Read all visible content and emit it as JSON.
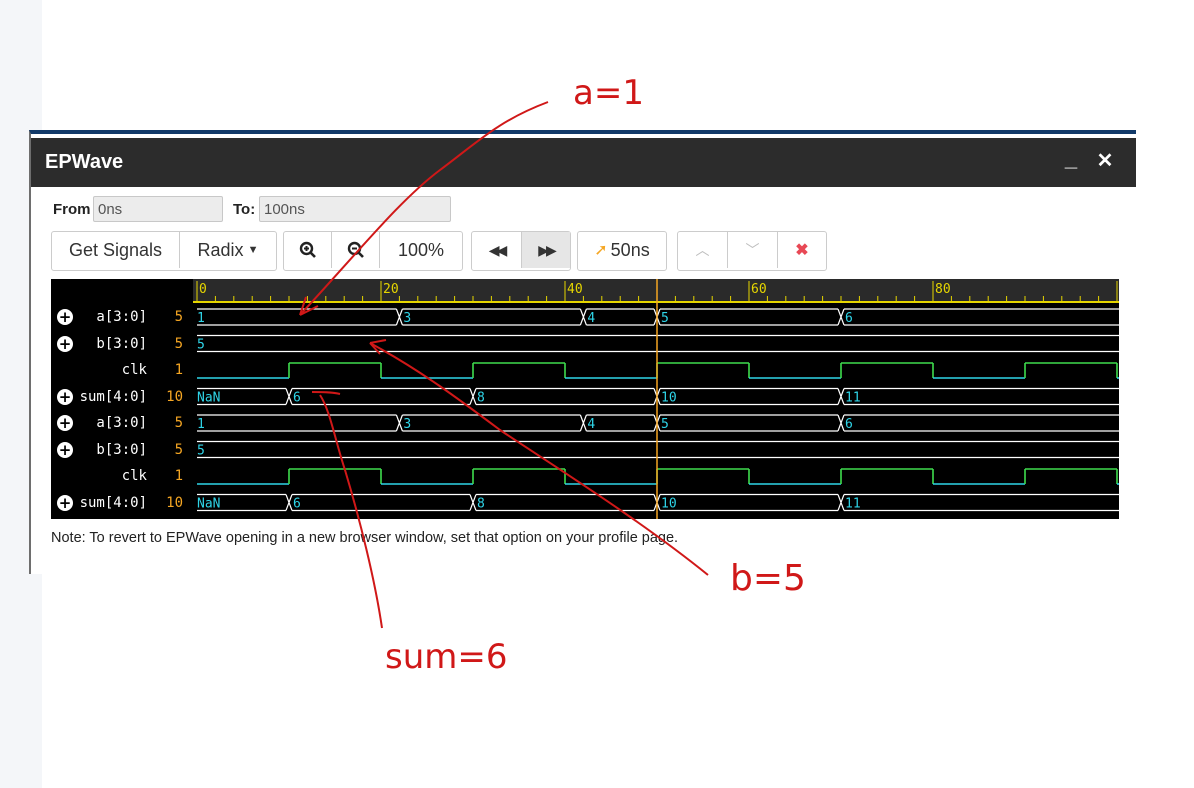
{
  "window": {
    "title": "EPWave"
  },
  "range": {
    "from_label": "From",
    "from_value": "0ns",
    "to_label": "To:",
    "to_value": "100ns"
  },
  "toolbar": {
    "get_signals": "Get Signals",
    "radix": "Radix",
    "zoom_level": "100%",
    "cursor_time": "50ns"
  },
  "ruler": {
    "ticks": [
      "0",
      "20",
      "40",
      "60",
      "80"
    ],
    "cursor_ns": 50
  },
  "signals": [
    {
      "name": "a[3:0]",
      "value": "5",
      "expandable": true
    },
    {
      "name": "b[3:0]",
      "value": "5",
      "expandable": true
    },
    {
      "name": "clk",
      "value": "1",
      "expandable": false
    },
    {
      "name": "sum[4:0]",
      "value": "10",
      "expandable": true
    },
    {
      "name": "a[3:0]",
      "value": "5",
      "expandable": true
    },
    {
      "name": "b[3:0]",
      "value": "5",
      "expandable": true
    },
    {
      "name": "clk",
      "value": "1",
      "expandable": false
    },
    {
      "name": "sum[4:0]",
      "value": "10",
      "expandable": true
    }
  ],
  "waves": {
    "a": [
      {
        "t": 0,
        "v": "1"
      },
      {
        "t": 22,
        "v": "3"
      },
      {
        "t": 42,
        "v": "4"
      },
      {
        "t": 50,
        "v": "5"
      },
      {
        "t": 70,
        "v": "6"
      }
    ],
    "b": [
      {
        "t": 0,
        "v": "5"
      }
    ],
    "clk_edges": [
      10,
      20,
      30,
      40,
      50,
      60,
      70,
      80,
      90,
      100
    ],
    "sum": [
      {
        "t": 0,
        "v": "NaN"
      },
      {
        "t": 10,
        "v": "6"
      },
      {
        "t": 30,
        "v": "8"
      },
      {
        "t": 50,
        "v": "10"
      },
      {
        "t": 70,
        "v": "11"
      }
    ]
  },
  "note": "Note: To revert to EPWave opening in a new browser window, set that option on your profile page.",
  "annotations": {
    "a": "a=1",
    "b": "b=5",
    "sum": "sum=6"
  }
}
